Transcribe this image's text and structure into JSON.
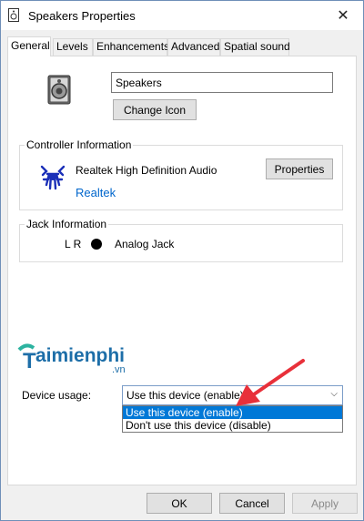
{
  "window": {
    "title": "Speakers Properties",
    "close_label": "✕"
  },
  "tabs": [
    {
      "label": "General",
      "active": true
    },
    {
      "label": "Levels"
    },
    {
      "label": "Enhancements"
    },
    {
      "label": "Advanced"
    },
    {
      "label": "Spatial sound"
    }
  ],
  "device": {
    "name_value": "Speakers",
    "change_icon_label": "Change Icon",
    "icon": "speaker-icon"
  },
  "controller": {
    "group_label": "Controller Information",
    "name": "Realtek High Definition Audio",
    "vendor_link": "Realtek",
    "properties_label": "Properties",
    "icon": "realtek-crab-icon"
  },
  "jack": {
    "group_label": "Jack Information",
    "channels": "L R",
    "type": "Analog Jack"
  },
  "watermark": {
    "text": "aimienphi",
    "suffix": ".vn"
  },
  "usage": {
    "label": "Device usage:",
    "selected": "Use this device (enable)",
    "options": [
      "Use this device (enable)",
      "Don't use this device (disable)"
    ]
  },
  "buttons": {
    "ok": "OK",
    "cancel": "Cancel",
    "apply": "Apply"
  },
  "colors": {
    "accent": "#0078d7",
    "arrow": "#e8303a",
    "link": "#0066cc"
  }
}
